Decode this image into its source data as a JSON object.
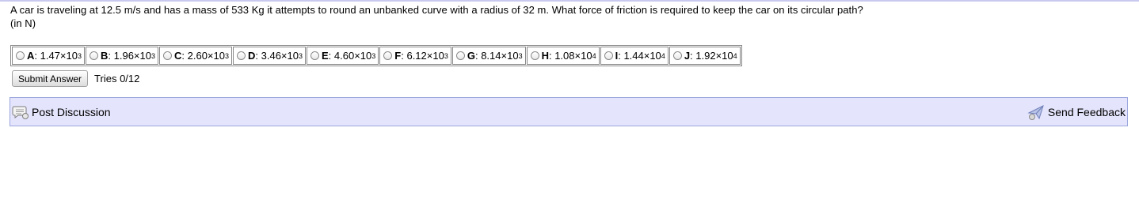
{
  "question": {
    "text": "A car is traveling at 12.5 m/s and has a mass of 533 Kg it attempts to round an unbanked curve with a radius of 32 m. What force of friction is required to keep the car on its circular path?",
    "units": "(in N)"
  },
  "choices": [
    {
      "letter": "A",
      "mantissa": "1.47×10",
      "exponent": "3"
    },
    {
      "letter": "B",
      "mantissa": "1.96×10",
      "exponent": "3"
    },
    {
      "letter": "C",
      "mantissa": "2.60×10",
      "exponent": "3"
    },
    {
      "letter": "D",
      "mantissa": "3.46×10",
      "exponent": "3"
    },
    {
      "letter": "E",
      "mantissa": "4.60×10",
      "exponent": "3"
    },
    {
      "letter": "F",
      "mantissa": "6.12×10",
      "exponent": "3"
    },
    {
      "letter": "G",
      "mantissa": "8.14×10",
      "exponent": "3"
    },
    {
      "letter": "H",
      "mantissa": "1.08×10",
      "exponent": "4"
    },
    {
      "letter": "I",
      "mantissa": "1.44×10",
      "exponent": "4"
    },
    {
      "letter": "J",
      "mantissa": "1.92×10",
      "exponent": "4"
    }
  ],
  "submit": {
    "label": "Submit Answer",
    "tries": "Tries 0/12"
  },
  "discussion_bar": {
    "post_label": "Post Discussion",
    "feedback_label": "Send Feedback",
    "post_icon": "discussion-bubble-icon",
    "feedback_icon": "send-feedback-icon"
  },
  "colors": {
    "bar_background": "#e4e4fc",
    "bar_border": "#9aa6dc",
    "top_rule": "#c9c9f0"
  }
}
